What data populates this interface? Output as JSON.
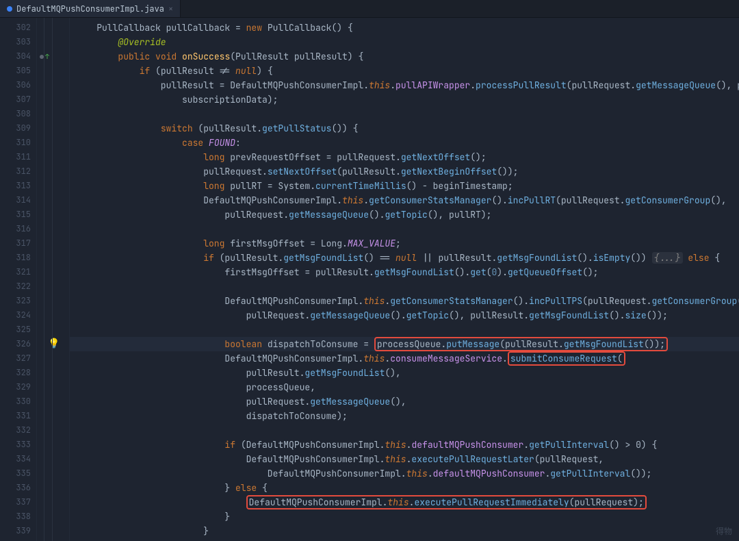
{
  "tab": {
    "filename": "DefaultMQPushConsumerImpl.java"
  },
  "gutter": {
    "lines": [
      302,
      303,
      304,
      305,
      306,
      307,
      308,
      309,
      310,
      311,
      312,
      313,
      314,
      315,
      316,
      317,
      318,
      321,
      322,
      323,
      324,
      325,
      326,
      327,
      328,
      329,
      330,
      331,
      332,
      333,
      334,
      335,
      336,
      337,
      338,
      339
    ]
  },
  "gutter_icons": {
    "bulb_line": 326,
    "uparrow_line": 304
  },
  "highlight_lines": [
    326
  ],
  "tokens": {
    "PullCallback": "PullCallback",
    "pullCallback": "pullCallback",
    "new": "new",
    "Override": "@Override",
    "public": "public",
    "void": "void",
    "onSuccess": "onSuccess",
    "PullResult": "PullResult",
    "pullResult": "pullResult",
    "if": "if",
    "null": "null",
    "DefaultMQPushConsumerImpl": "DefaultMQPushConsumerImpl",
    "this": "this",
    "pullAPIWrapper": "pullAPIWrapper",
    "processPullResult": "processPullResult",
    "pullRequest": "pullRequest",
    "getMessageQueue": "getMessageQueue",
    "pullR": "pullR",
    "subscriptionData": "subscriptionData",
    "switch": "switch",
    "getPullStatus": "getPullStatus",
    "case": "case",
    "FOUND": "FOUND",
    "long": "long",
    "prevRequestOffset": "prevRequestOffset",
    "getNextOffset": "getNextOffset",
    "setNextOffset": "setNextOffset",
    "getNextBeginOffset": "getNextBeginOffset",
    "pullRT": "pullRT",
    "System": "System",
    "currentTimeMillis": "currentTimeMillis",
    "beginTimestamp": "beginTimestamp",
    "getConsumerStatsManager": "getConsumerStatsManager",
    "incPullRT": "incPullRT",
    "getConsumerGroup": "getConsumerGroup",
    "getTopic": "getTopic",
    "firstMsgOffset": "firstMsgOffset",
    "Long": "Long",
    "MAX_VALUE": "MAX_VALUE",
    "getMsgFoundList": "getMsgFoundList",
    "isEmpty": "isEmpty",
    "fold": "{...}",
    "else": "else",
    "get": "get",
    "zero": "0",
    "getQueueOffset": "getQueueOffset",
    "incPullTPS": "incPullTPS",
    "size": "size",
    "boolean": "boolean",
    "dispatchToConsume": "dispatchToConsume",
    "processQueue": "processQueue",
    "putMessage": "putMessage",
    "consumeMessageService": "consumeMessageService",
    "submitConsumeRequest": "submitConsumeRequest",
    "defaultMQPushConsumer": "defaultMQPushConsumer",
    "getPullInterval": "getPullInterval",
    "gt": "> 0",
    "executePullRequestLater": "executePullRequestLater",
    "executePullRequestImmediately": "executePullRequestImmediately"
  },
  "watermark": "得物"
}
